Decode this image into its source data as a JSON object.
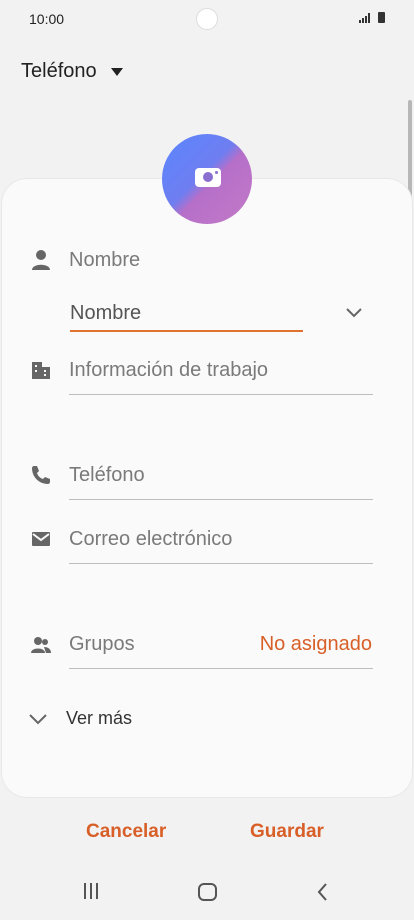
{
  "status_bar": {
    "time": "10:00"
  },
  "account": {
    "label": "Teléfono"
  },
  "fields": {
    "name_section_label": "Nombre",
    "name_placeholder": "Nombre",
    "work_info": "Información de trabajo",
    "phone": "Teléfono",
    "email": "Correo electrónico",
    "groups_label": "Grupos",
    "groups_value": "No asignado",
    "see_more": "Ver más"
  },
  "actions": {
    "cancel": "Cancelar",
    "save": "Guardar"
  },
  "colors": {
    "accent": "#d85f28",
    "input_underline": "#e0712f"
  },
  "icons": [
    "person-icon",
    "building-icon",
    "phone-icon",
    "email-icon",
    "group-icon",
    "camera-icon",
    "chevron-down-icon"
  ]
}
